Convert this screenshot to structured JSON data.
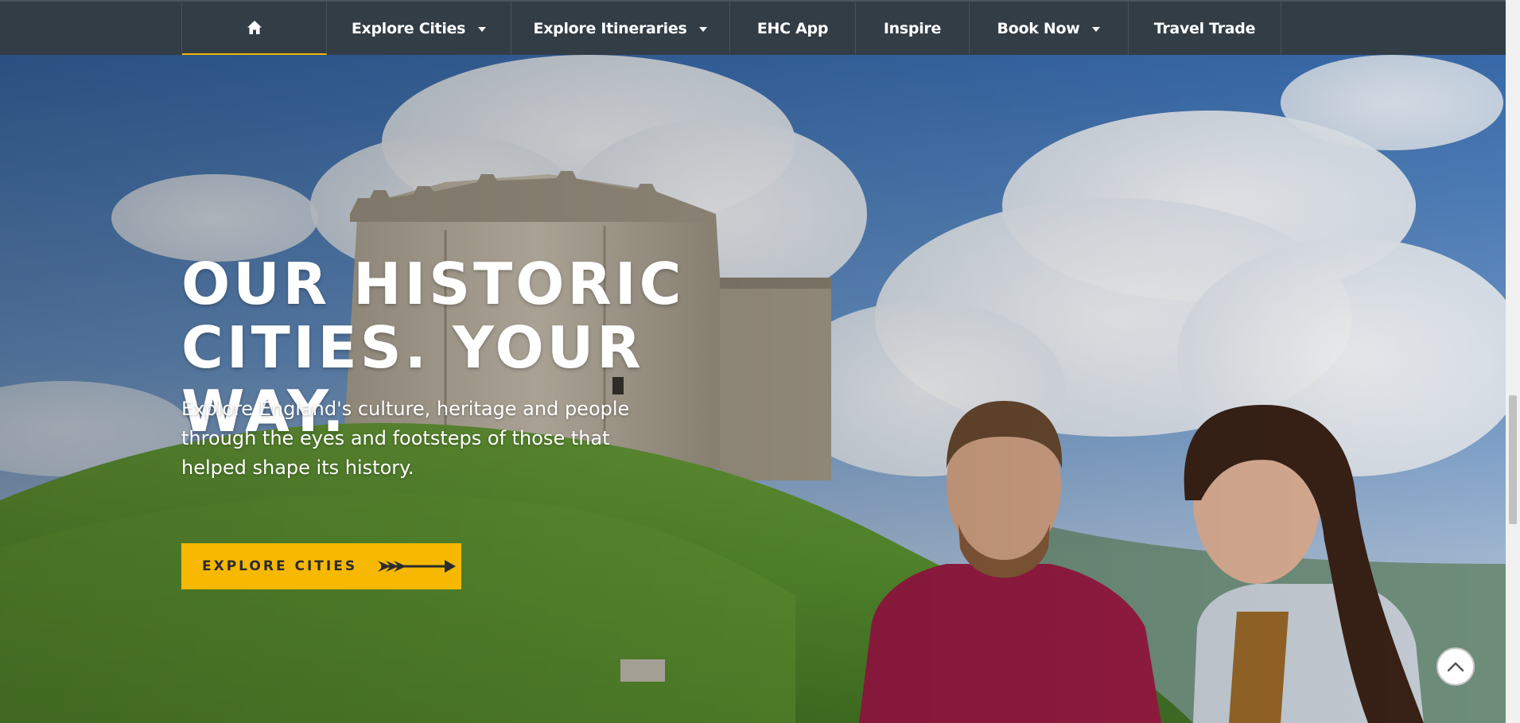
{
  "nav": {
    "home_icon": "home-icon",
    "items": [
      {
        "label": "Explore Cities",
        "has_dropdown": true
      },
      {
        "label": "Explore Itineraries",
        "has_dropdown": true
      },
      {
        "label": "EHC App",
        "has_dropdown": false
      },
      {
        "label": "Inspire",
        "has_dropdown": false
      },
      {
        "label": "Book Now",
        "has_dropdown": true
      },
      {
        "label": "Travel Trade",
        "has_dropdown": false
      }
    ],
    "active_indicator_color": "#f5b800"
  },
  "hero": {
    "title_line1": "OUR HISTORIC",
    "title_line2": "CITIES. YOUR WAY.",
    "subtitle": "Explore England's culture, heritage and people through the eyes and footsteps of those that helped shape its history.",
    "cta_label": "EXPLORE CITIES",
    "cta_icon": "arrow-right-icon",
    "cta_color": "#f6b800"
  },
  "scroll_top_icon": "chevron-up-icon",
  "colors": {
    "navbar": "#323d46",
    "accent": "#f5b800"
  }
}
